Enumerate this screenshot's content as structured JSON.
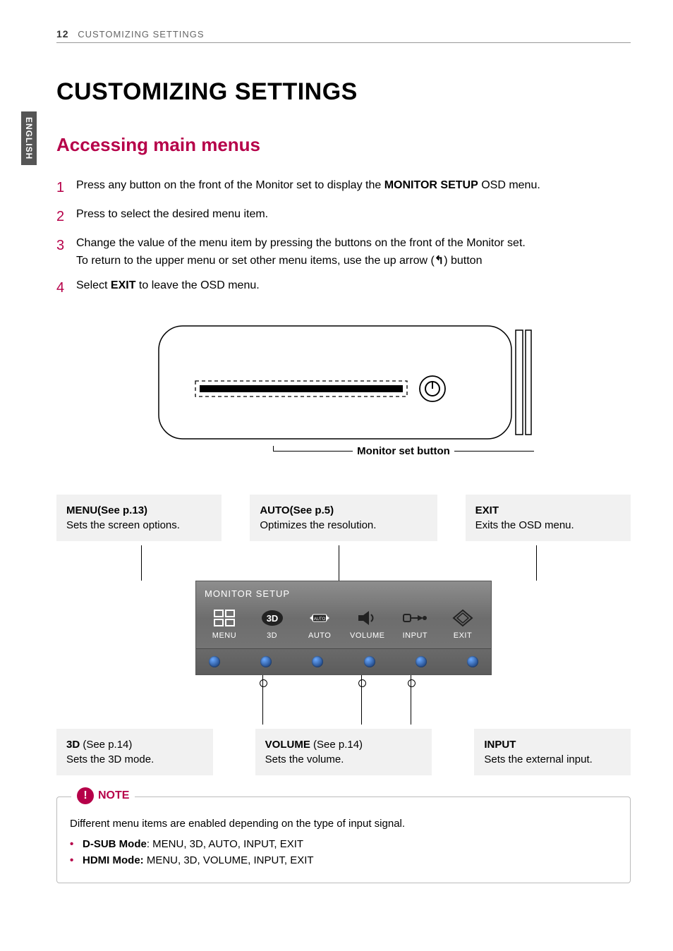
{
  "page": {
    "number": "12",
    "running_title": "CUSTOMIZING SETTINGS",
    "side_tab": "ENGLISH"
  },
  "title": "CUSTOMIZING SETTINGS",
  "subtitle": "Accessing main menus",
  "steps": {
    "1": {
      "num": "1",
      "pre": "Press any button on the front of the Monitor set to display the ",
      "bold": "MONITOR SETUP",
      "post": " OSD menu."
    },
    "2": {
      "num": "2",
      "pre": "Press to select the desired menu item.",
      "bold": "",
      "post": ""
    },
    "3": {
      "num": "3",
      "line1_pre": "Change the value of the menu item by pressing the buttons on the front of the Monitor set.",
      "line2_pre": "To return to the upper menu or set other menu items, use the up arrow (",
      "line2_post": ") button"
    },
    "4": {
      "num": "4",
      "pre": "Select ",
      "bold": "EXIT",
      "post": " to leave the OSD menu."
    }
  },
  "diagram": {
    "label": "Monitor set button"
  },
  "top_boxes": {
    "menu": {
      "title": "MENU(See p.13)",
      "desc": "Sets the screen options."
    },
    "auto": {
      "title": "AUTO(See p.5)",
      "desc": "Optimizes the resolution."
    },
    "exit": {
      "title": "EXIT",
      "desc": "Exits the OSD menu."
    }
  },
  "osd": {
    "title": "MONITOR SETUP",
    "labels": [
      "MENU",
      "3D",
      "AUTO",
      "VOLUME",
      "INPUT",
      "EXIT"
    ]
  },
  "bottom_boxes": {
    "three_d": {
      "title": "3D ",
      "ref": "(See p.14)",
      "desc": "Sets the 3D mode."
    },
    "volume": {
      "title": "VOLUME ",
      "ref": "(See p.14)",
      "desc": "Sets the volume."
    },
    "input": {
      "title": "INPUT",
      "ref": "",
      "desc": "Sets the external input."
    }
  },
  "note": {
    "label": "NOTE",
    "intro": "Different menu items are enabled depending on the type of input signal.",
    "items": {
      "dsub": {
        "bold": "D-SUB Mode",
        "rest": ": MENU, 3D, AUTO, INPUT, EXIT"
      },
      "hdmi": {
        "bold": "HDMI Mode:",
        "rest": " MENU, 3D, VOLUME, INPUT, EXIT"
      }
    }
  }
}
